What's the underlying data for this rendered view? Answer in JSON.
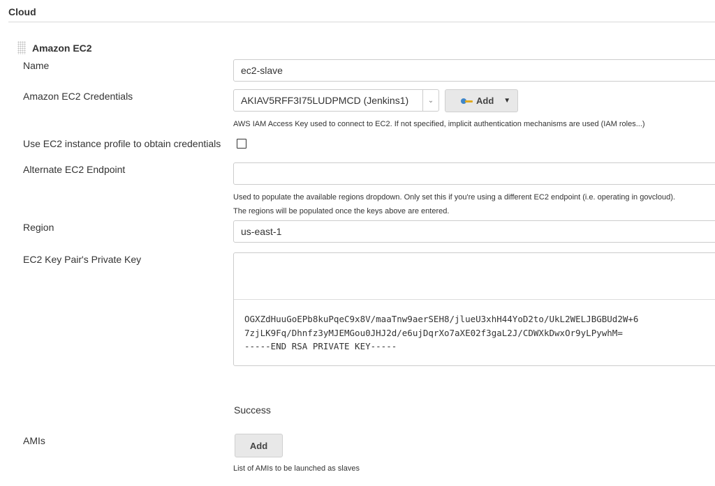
{
  "section": {
    "title": "Cloud"
  },
  "cloud": {
    "title": "Amazon EC2",
    "name": {
      "label": "Name",
      "value": "ec2-slave"
    },
    "credentials": {
      "label": "Amazon EC2 Credentials",
      "selected": "AKIAV5RFF3I75LUDPMCD (Jenkins1)",
      "add_label": "Add",
      "help": "AWS IAM Access Key used to connect to EC2. If not specified, implicit authentication mechanisms are used (IAM roles...)"
    },
    "instance_profile": {
      "label": "Use EC2 instance profile to obtain credentials",
      "checked": false
    },
    "endpoint": {
      "label": "Alternate EC2 Endpoint",
      "value": "",
      "help_line1": "Used to populate the available regions dropdown. Only set this if you're using a different EC2 endpoint (i.e. operating in govcloud).",
      "help_line2": "The regions will be populated once the keys above are entered."
    },
    "region": {
      "label": "Region",
      "value": "us-east-1"
    },
    "private_key": {
      "label": "EC2 Key Pair's Private Key",
      "lines": [
        "OGXZdHuuGoEPb8kuPqeC9x8V/maaTnw9aerSEH8/jlueU3xhH44YoD2to/UkL2WELJBGBUd2W+6",
        "7zjLK9Fq/Dhnfz3yMJEMGou0JHJ2d/e6ujDqrXo7aXE02f3gaL2J/CDWXkDwxOr9yLPywhM=",
        "-----END RSA PRIVATE KEY-----"
      ]
    },
    "test_status": "Success",
    "amis": {
      "label": "AMIs",
      "add_label": "Add",
      "help": "List of AMIs to be launched as slaves"
    }
  },
  "icons": {
    "drag": "drag-handle-icon",
    "key": "key-icon",
    "dropdown": "chevron-down-icon",
    "caret": "caret-down-icon"
  }
}
